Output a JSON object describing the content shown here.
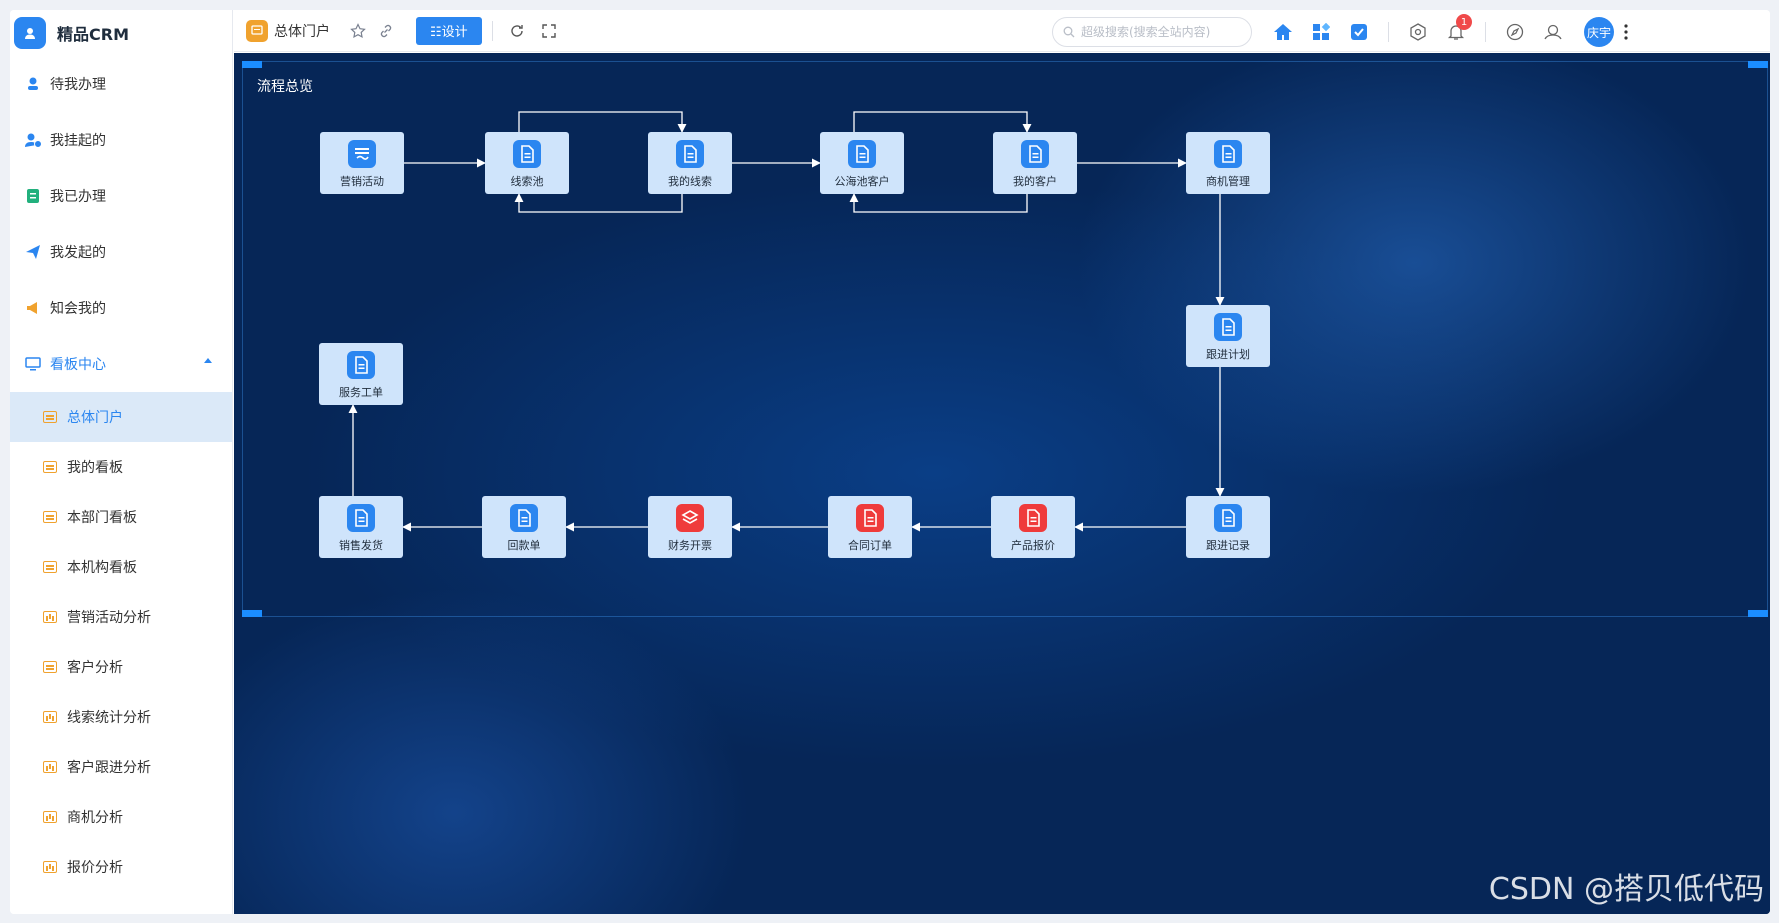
{
  "app": {
    "name": "精品CRM"
  },
  "sidebar": {
    "items": [
      {
        "label": "待我办理",
        "icon": "user-pin-icon",
        "color": "#2b86f0"
      },
      {
        "label": "我挂起的",
        "icon": "user-pause-icon",
        "color": "#2b86f0"
      },
      {
        "label": "我已办理",
        "icon": "done-list-icon",
        "color": "#22b07d"
      },
      {
        "label": "我发起的",
        "icon": "paper-plane-icon",
        "color": "#2b86f0"
      },
      {
        "label": "知会我的",
        "icon": "megaphone-icon",
        "color": "#f0a22e"
      }
    ],
    "group": {
      "label": "看板中心",
      "icon": "monitor-icon"
    },
    "subitems": [
      {
        "label": "总体门户",
        "icon": "board",
        "active": true
      },
      {
        "label": "我的看板",
        "icon": "board"
      },
      {
        "label": "本部门看板",
        "icon": "board"
      },
      {
        "label": "本机构看板",
        "icon": "board"
      },
      {
        "label": "营销活动分析",
        "icon": "chart"
      },
      {
        "label": "客户分析",
        "icon": "board"
      },
      {
        "label": "线索统计分析",
        "icon": "chart"
      },
      {
        "label": "客户跟进分析",
        "icon": "chart"
      },
      {
        "label": "商机分析",
        "icon": "chart"
      },
      {
        "label": "报价分析",
        "icon": "chart"
      }
    ]
  },
  "topbar": {
    "tab_title": "总体门户",
    "design_label": "☷设计",
    "search_placeholder": "超级搜索(搜索全站内容)",
    "notification_count": "1",
    "user_name": "庆宇"
  },
  "flow": {
    "title": "流程总览",
    "nodes": [
      {
        "id": "n1",
        "label": "营销活动",
        "icon": "handshake-icon",
        "color": "blue"
      },
      {
        "id": "n2",
        "label": "线索池",
        "icon": "document-icon",
        "color": "blue"
      },
      {
        "id": "n3",
        "label": "我的线索",
        "icon": "document-icon",
        "color": "blue"
      },
      {
        "id": "n4",
        "label": "公海池客户",
        "icon": "document-icon",
        "color": "blue"
      },
      {
        "id": "n5",
        "label": "我的客户",
        "icon": "document-icon",
        "color": "blue"
      },
      {
        "id": "n6",
        "label": "商机管理",
        "icon": "document-icon",
        "color": "blue"
      },
      {
        "id": "n7",
        "label": "跟进计划",
        "icon": "document-icon",
        "color": "blue"
      },
      {
        "id": "n8",
        "label": "跟进记录",
        "icon": "document-icon",
        "color": "blue"
      },
      {
        "id": "n9",
        "label": "产品报价",
        "icon": "document-icon",
        "color": "red"
      },
      {
        "id": "n10",
        "label": "合同订单",
        "icon": "document-icon",
        "color": "red"
      },
      {
        "id": "n11",
        "label": "财务开票",
        "icon": "layers-icon",
        "color": "red"
      },
      {
        "id": "n12",
        "label": "回款单",
        "icon": "document-icon",
        "color": "blue"
      },
      {
        "id": "n13",
        "label": "销售发货",
        "icon": "document-icon",
        "color": "blue"
      },
      {
        "id": "n14",
        "label": "服务工单",
        "icon": "document-icon",
        "color": "blue"
      }
    ],
    "edges": [
      [
        "n1",
        "n2"
      ],
      [
        "n2",
        "n3"
      ],
      [
        "n3",
        "n2"
      ],
      [
        "n3",
        "n4"
      ],
      [
        "n4",
        "n5"
      ],
      [
        "n5",
        "n4"
      ],
      [
        "n5",
        "n6"
      ],
      [
        "n6",
        "n7"
      ],
      [
        "n7",
        "n8"
      ],
      [
        "n8",
        "n9"
      ],
      [
        "n9",
        "n10"
      ],
      [
        "n10",
        "n11"
      ],
      [
        "n11",
        "n12"
      ],
      [
        "n12",
        "n13"
      ],
      [
        "n13",
        "n14"
      ]
    ]
  },
  "watermark": "CSDN @搭贝低代码",
  "colors": {
    "accent": "#2b86f0",
    "warn": "#f0a22e",
    "danger": "#ef3b3b",
    "node_bg": "#cfe4fb"
  }
}
